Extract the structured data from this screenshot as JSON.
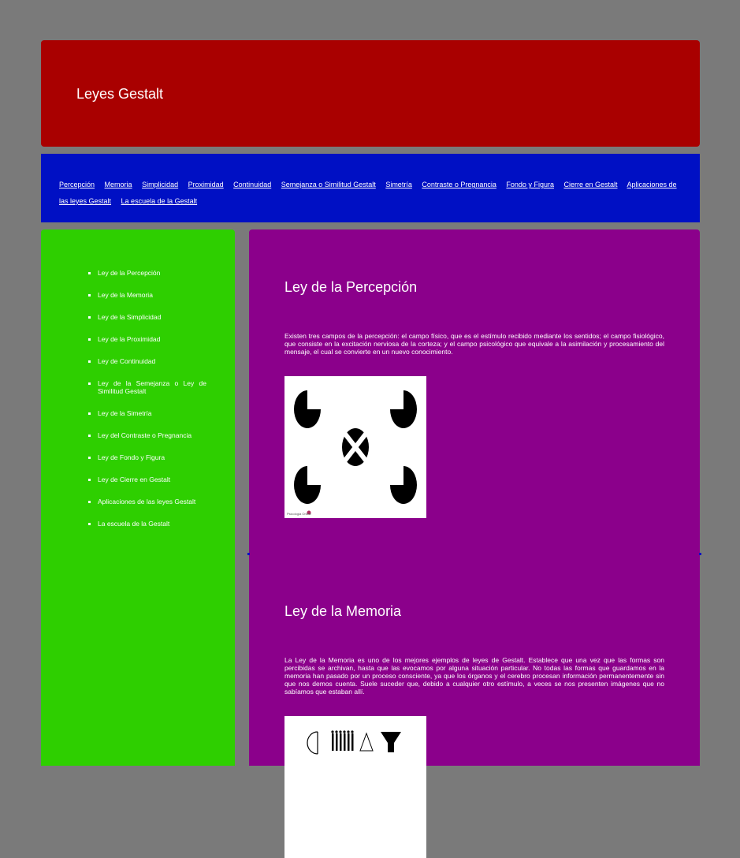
{
  "header": {
    "title": "Leyes Gestalt"
  },
  "nav": {
    "links": [
      "Percepción",
      "Memoria",
      "Simplicidad",
      "Proximidad",
      "Continuidad",
      "Semejanza o Similitud Gestalt",
      "Simetría",
      "Contraste o Pregnancia",
      "Fondo y Figura",
      "Cierre en Gestalt",
      "Aplicaciones de las leyes Gestalt",
      "La escuela de la Gestalt"
    ]
  },
  "sidebar": {
    "items": [
      "Ley de la Percepción",
      "Ley de la Memoria",
      "Ley de la Simplicidad",
      "Ley de la Proximidad",
      "Ley de Continuidad",
      "Ley de la Semejanza o Ley de Similitud Gestalt",
      "Ley de la Simetría",
      "Ley del Contraste o Pregnancia",
      "Ley de Fondo y Figura",
      "Ley de Cierre en Gestalt",
      "Aplicaciones de las leyes Gestalt",
      "La escuela de la Gestalt"
    ]
  },
  "sections": [
    {
      "title": "Ley de la Percepción",
      "text": "Existen tres campos de la percepción: el campo físico, que es el estímulo recibido mediante los sentidos; el campo fisiológico, que consiste en la excitación nerviosa de la corteza; y el campo psicológico que equivale a la asimilación y procesamiento del mensaje, el cual se convierte en un nuevo conocimiento.",
      "figure_caption": "Psicologia Online"
    },
    {
      "title": "Ley de la Memoria",
      "text": "La Ley de la Memoria es uno de los mejores ejemplos de leyes de Gestalt. Establece que una vez que las formas son percibidas se archivan, hasta que las evocamos por alguna situación particular. No todas las formas que guardamos en la memoria han pasado por un proceso consciente, ya que los órganos y el cerebro procesan información permanentemente sin que nos demos cuenta. Suele suceder que, debido a cualquier otro estímulo, a veces se nos presenten imágenes que no sabíamos que estaban allí."
    }
  ],
  "colors": {
    "page_bg": "#7a7a7a",
    "header_bg": "#a90000",
    "nav_bg": "#0010c4",
    "sidebar_bg": "#2ecf00",
    "main_bg": "#8b008b"
  }
}
